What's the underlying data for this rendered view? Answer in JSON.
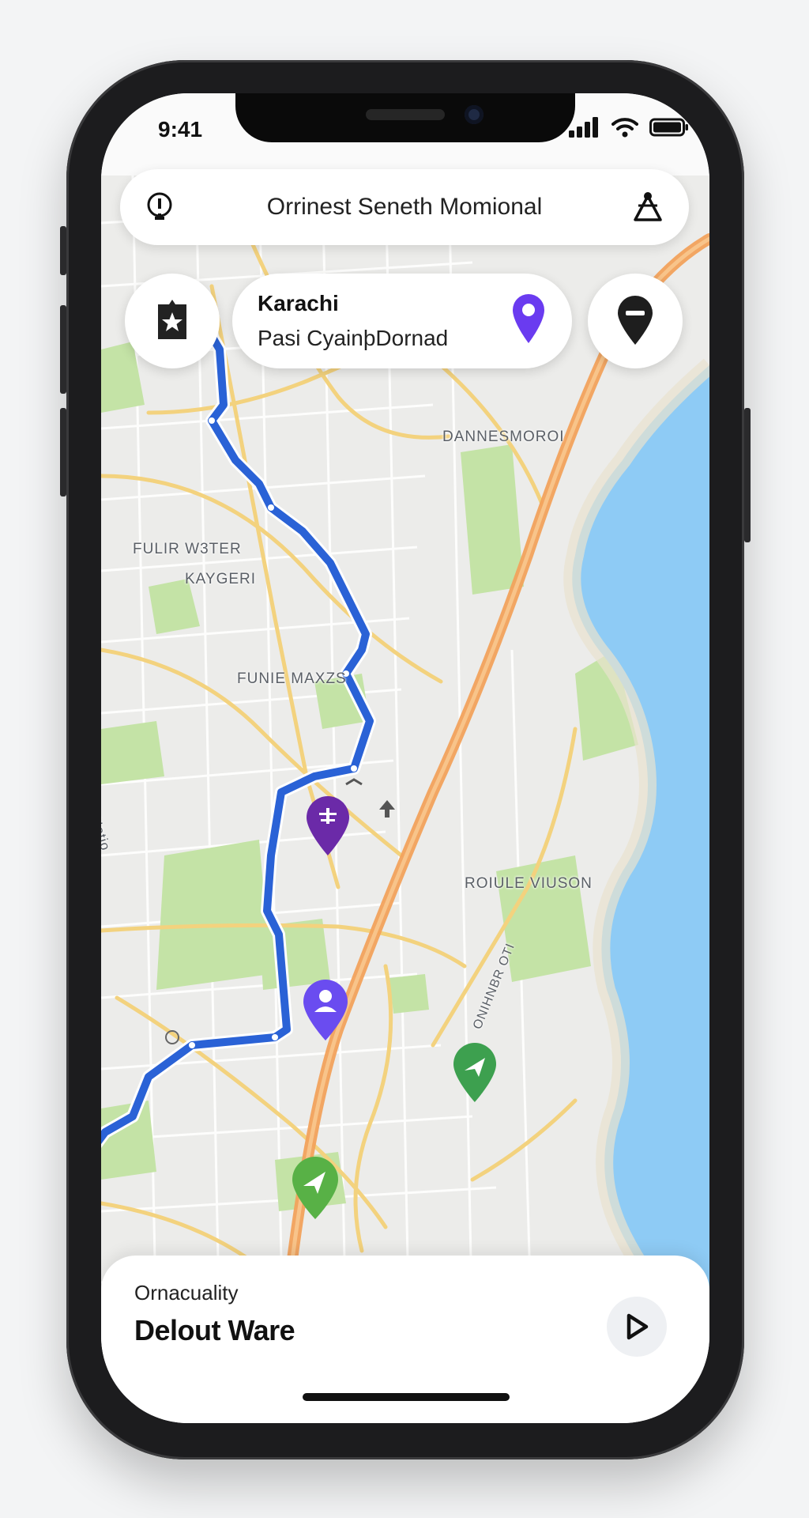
{
  "status_bar": {
    "time": "9:41"
  },
  "search": {
    "text": "Orrinest Seneth Momional"
  },
  "destination": {
    "title": "Karachi",
    "subtitle": "Pasi Cyainþ​Dornad"
  },
  "map_labels": [
    "DANNESMOROI",
    "FULIR W3TER",
    "KAYGERI",
    "FUNIE MAXZS",
    "ROIULE VIUSON",
    "Yanum Notio",
    "ONIHNBR OTI"
  ],
  "bottom_sheet": {
    "subtitle": "Ornacuality",
    "title": "Delout Ware"
  },
  "colors": {
    "route": "#2a62d6",
    "highway": "#f2a25c",
    "water": "#8ecbf5",
    "park": "#c4e3a6",
    "pin_purple": "#6b2aa8",
    "pin_violet": "#6a4cf0",
    "pin_green": "#3da04f"
  },
  "icons": {
    "search_leading": "info-pin-icon",
    "search_trailing": "route-nodes-icon",
    "left_button": "bookmark-star-icon",
    "right_button": "pin-minus-icon",
    "dest_pin": "location-pin-icon",
    "play": "play-icon"
  }
}
